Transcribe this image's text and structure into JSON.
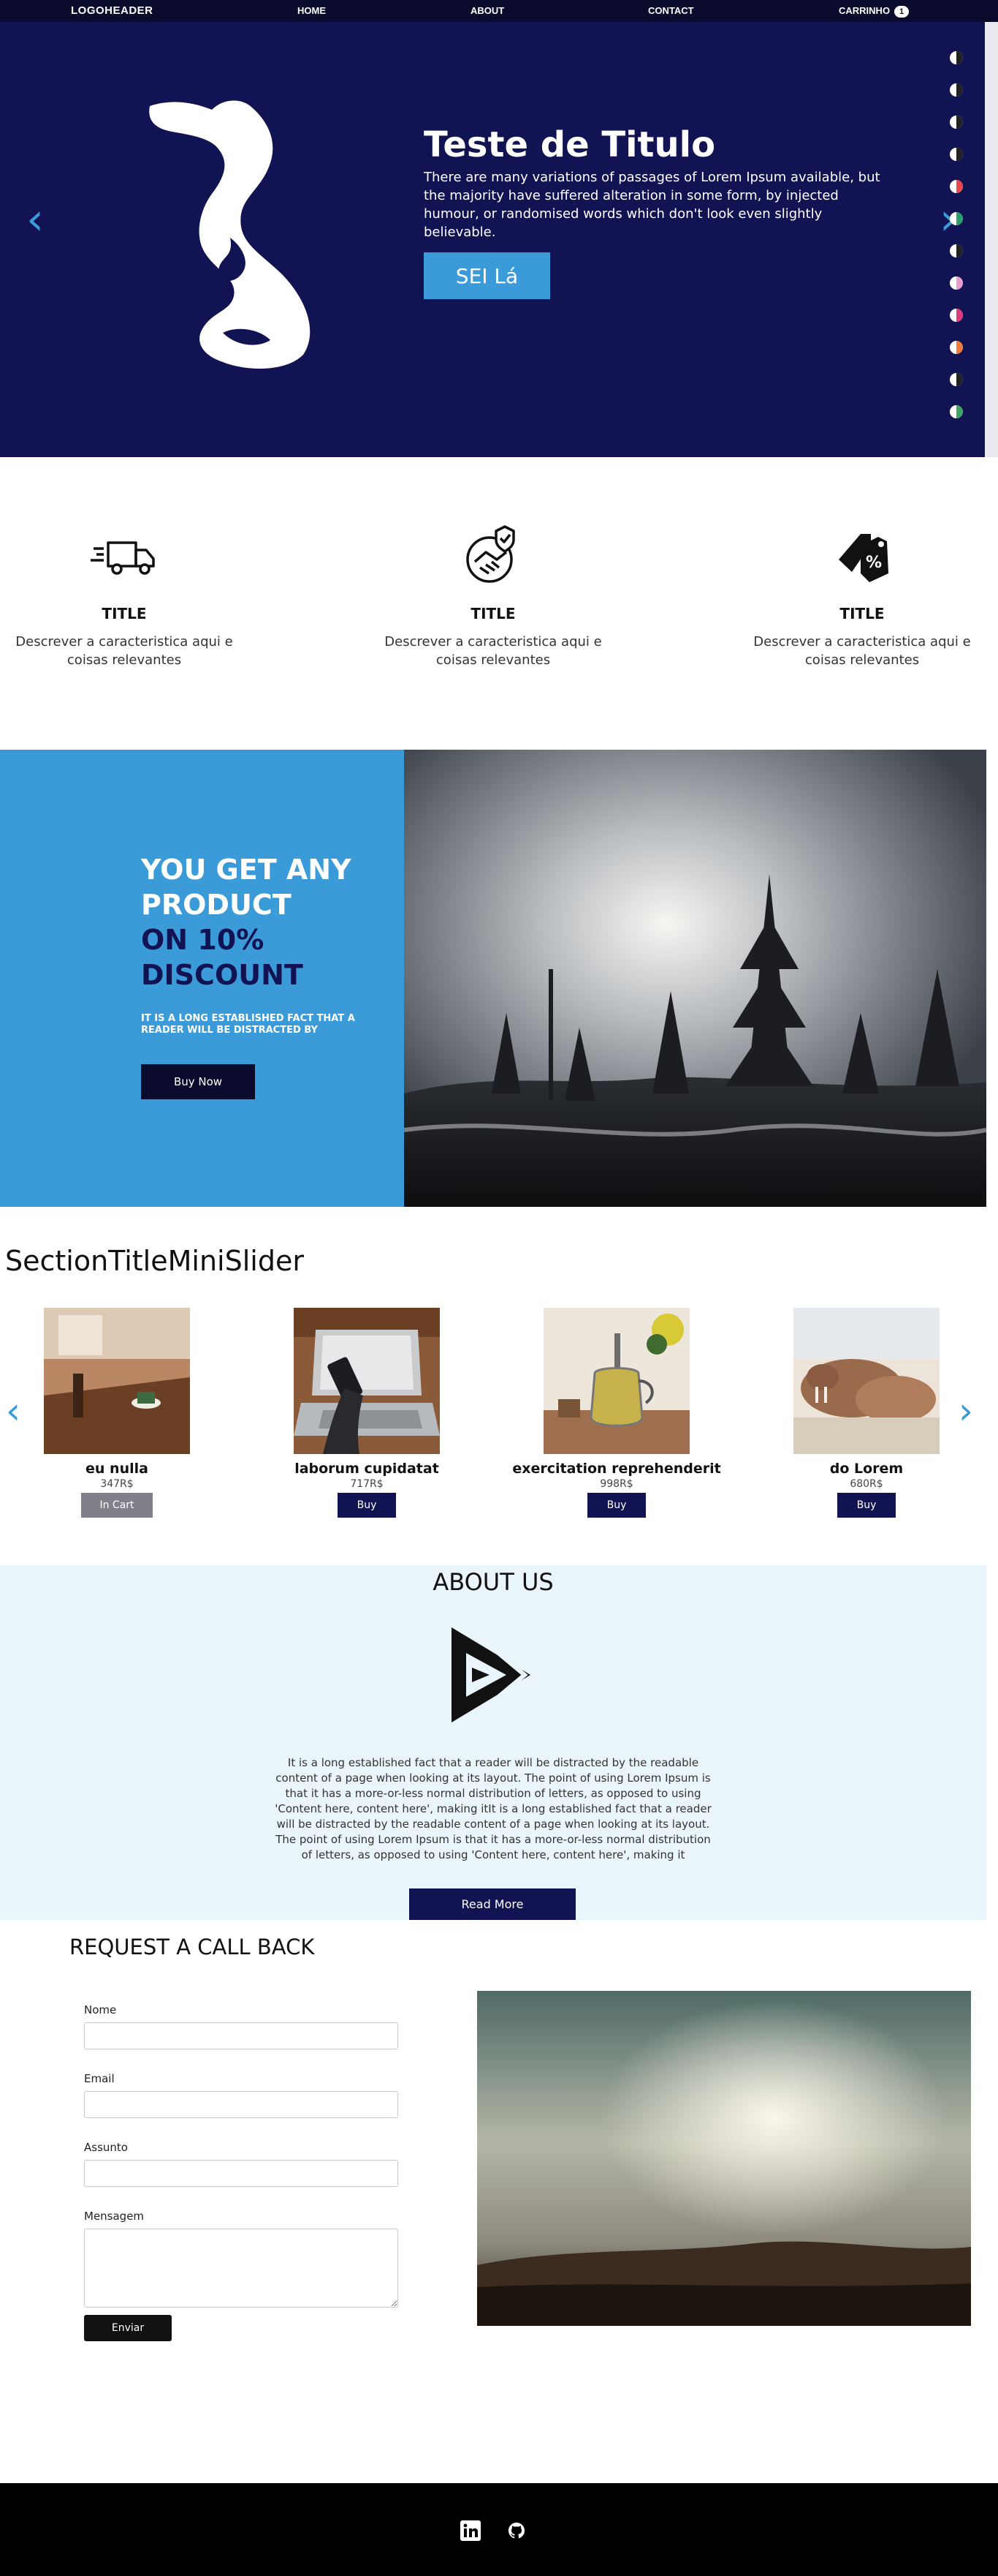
{
  "header": {
    "logo": "LOGOHEADER",
    "nav": [
      "HOME",
      "ABOUT",
      "CONTACT"
    ],
    "cart_label": "CARRINHO",
    "cart_count": "1"
  },
  "hero": {
    "title": "Teste de Titulo",
    "description": "There are many variations of passages of Lorem Ipsum available, but the majority have suffered alteration in some form, by injected humour, or randomised words which don't look even slightly believable.",
    "cta_label": "SEI Lá",
    "prev_icon": "chevron-left-icon",
    "next_icon": "chevron-right-icon"
  },
  "features": [
    {
      "icon": "fast-delivery-truck-icon",
      "title": "TITLE",
      "text": "Descrever a caracteristica aqui e coisas relevantes"
    },
    {
      "icon": "secure-handshake-icon",
      "title": "TITLE",
      "text": "Descrever a caracteristica aqui e coisas relevantes"
    },
    {
      "icon": "discount-tag-icon",
      "title": "TITLE",
      "text": "Descrever a caracteristica aqui e coisas relevantes"
    }
  ],
  "discount": {
    "line1a": "YOU GET ANY",
    "line1b": "PRODUCT",
    "line2a": "ON 10%",
    "line2b": "DISCOUNT",
    "small": "IT IS A LONG ESTABLISHED FACT THAT A READER WILL BE DISTRACTED BY",
    "button": "Buy Now"
  },
  "mini_slider": {
    "title": "SectionTitleMiniSlider",
    "products": [
      {
        "name": "eu nulla",
        "price": "347R$",
        "button": "In Cart",
        "in_cart": true
      },
      {
        "name": "laborum cupidatat",
        "price": "717R$",
        "button": "Buy",
        "in_cart": false
      },
      {
        "name": "exercitation reprehenderit",
        "price": "998R$",
        "button": "Buy",
        "in_cart": false
      },
      {
        "name": "do Lorem",
        "price": "680R$",
        "button": "Buy",
        "in_cart": false
      }
    ]
  },
  "about": {
    "title": "ABOUT US",
    "text": "It is a long established fact that a reader will be distracted by the readable content of a page when looking at its layout. The point of using Lorem Ipsum is that it has a more-or-less normal distribution of letters, as opposed to using 'Content here, content here', making itIt is a long established fact that a reader will be distracted by the readable content of a page when looking at its layout. The point of using Lorem Ipsum is that it has a more-or-less normal distribution of letters, as opposed to using 'Content here, content here', making it",
    "button": "Read More"
  },
  "callback": {
    "title": "REQUEST A CALL BACK",
    "fields": {
      "name": {
        "label": "Nome",
        "value": ""
      },
      "email": {
        "label": "Email",
        "value": ""
      },
      "subject": {
        "label": "Assunto",
        "value": ""
      },
      "message": {
        "label": "Mensagem",
        "value": ""
      }
    },
    "submit": "Enviar"
  },
  "footer": {
    "icons": [
      "linkedin-icon",
      "github-icon"
    ]
  },
  "colors": {
    "navy": "#121353",
    "dark": "#0b0b2e",
    "accent_blue": "#3b9bd8",
    "about_bg": "#eaf4fb"
  }
}
